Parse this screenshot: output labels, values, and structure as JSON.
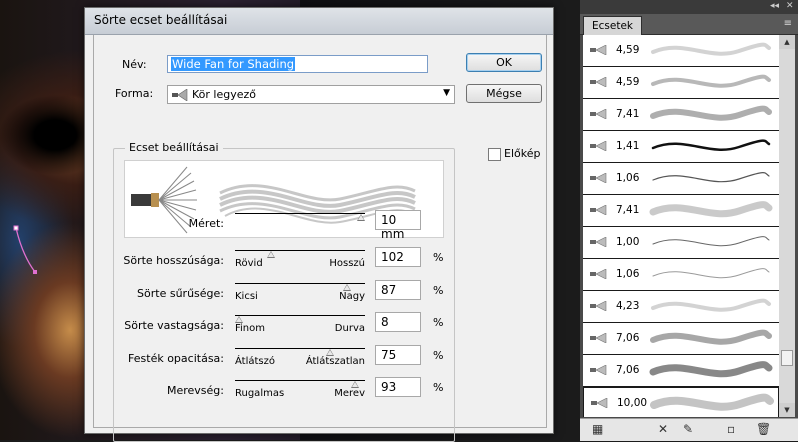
{
  "dialog": {
    "title": "Sörte ecset beállításai",
    "name_label": "Név:",
    "name_value": "Wide Fan for Shading",
    "shape_label": "Forma:",
    "shape_value": "Kör legyező",
    "ok_label": "OK",
    "cancel_label": "Mégse",
    "preview_label": "Előkép",
    "preview_checked": false,
    "group_title": "Ecset beállításai",
    "sliders": [
      {
        "label": "Méret:",
        "min": "",
        "max": "",
        "value": "10 mm",
        "unit": "",
        "position": 0.97
      },
      {
        "label": "Sörte hosszúsága:",
        "min": "Rövid",
        "max": "Hosszú",
        "value": "102",
        "unit": "%",
        "position": 0.28
      },
      {
        "label": "Sörte sűrűsége:",
        "min": "Kicsi",
        "max": "Nagy",
        "value": "87",
        "unit": "%",
        "position": 0.86
      },
      {
        "label": "Sörte vastagsága:",
        "min": "Finom",
        "max": "Durva",
        "value": "8",
        "unit": "%",
        "position": 0.03
      },
      {
        "label": "Festék opacitása:",
        "min": "Átlátszó",
        "max": "Átlátszatlan",
        "value": "75",
        "unit": "%",
        "position": 0.73
      },
      {
        "label": "Merevség:",
        "min": "Rugalmas",
        "max": "Merev",
        "value": "93",
        "unit": "%",
        "position": 0.92
      }
    ]
  },
  "panel": {
    "tab_label": "Ecsetek",
    "collapse_glyph": "◂◂",
    "close_glyph": "✕",
    "menu_glyph": "≡",
    "brushes": [
      {
        "size": "4,59",
        "style": "soft-light"
      },
      {
        "size": "4,59",
        "style": "soft-medium"
      },
      {
        "size": "7,41",
        "style": "soft-heavy"
      },
      {
        "size": "1,41",
        "style": "ink"
      },
      {
        "size": "1,06",
        "style": "thin-dark"
      },
      {
        "size": "7,41",
        "style": "soft-wide"
      },
      {
        "size": "1,00",
        "style": "thin"
      },
      {
        "size": "1,06",
        "style": "thin-light"
      },
      {
        "size": "4,23",
        "style": "soft-light"
      },
      {
        "size": "7,06",
        "style": "bristle"
      },
      {
        "size": "7,06",
        "style": "bristle-dark"
      },
      {
        "size": "10,00",
        "style": "bristle-wide",
        "selected": true
      }
    ],
    "bottom_icons": [
      "brush-library-icon",
      "remove-stroke-icon",
      "brush-options-icon",
      "new-brush-icon",
      "delete-brush-icon"
    ]
  },
  "colors": {
    "selection": "#3399ff",
    "default_button_border": "#3c7fb1"
  }
}
